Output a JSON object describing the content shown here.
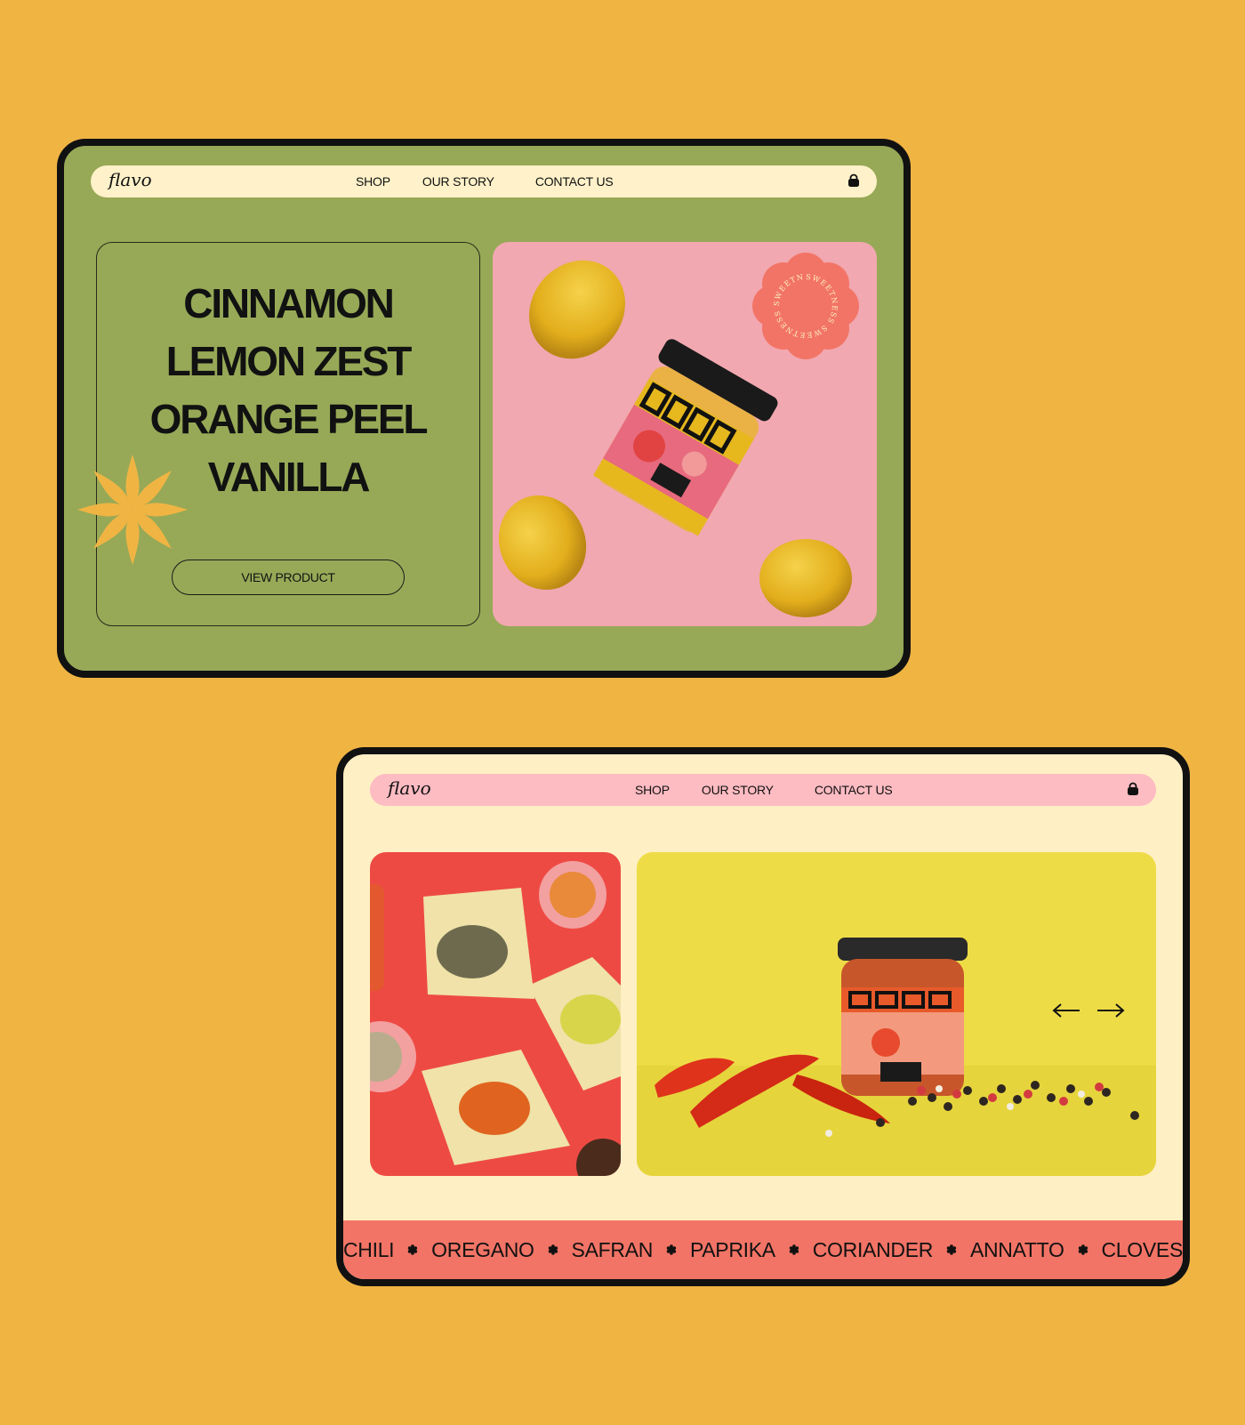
{
  "brand": "flavo",
  "nav": {
    "links": [
      "SHOP",
      "OUR STORY",
      "CONTACT US"
    ]
  },
  "icons": {
    "cart": "shopping-bag-icon",
    "prev": "arrow-left-icon",
    "next": "arrow-right-icon",
    "ticker_separator": "asterisk-icon",
    "decoration": "flower-icon"
  },
  "hero": {
    "flavors": [
      "CINNAMON",
      "LEMON ZEST",
      "ORANGE PEEL",
      "VANILLA"
    ],
    "cta": "VIEW PRODUCT",
    "badge": "SWEETNESS SWEETNESS SWEETNESS"
  },
  "ticker": {
    "items": [
      "CHILI",
      "OREGANO",
      "SAFRAN",
      "PAPRIKA",
      "CORIANDER",
      "ANNATTO",
      "CLOVES"
    ]
  },
  "colors": {
    "background": "#F0B443",
    "screen1": "#97A957",
    "screen2": "#FFEFC4",
    "nav1": "#FFF1C9",
    "nav2": "#FDBBC2",
    "ticker": "#F27466",
    "pink_photo": "#F1A8B0",
    "red_photo": "#EE4A44",
    "yellow_photo": "#EEDC47"
  }
}
